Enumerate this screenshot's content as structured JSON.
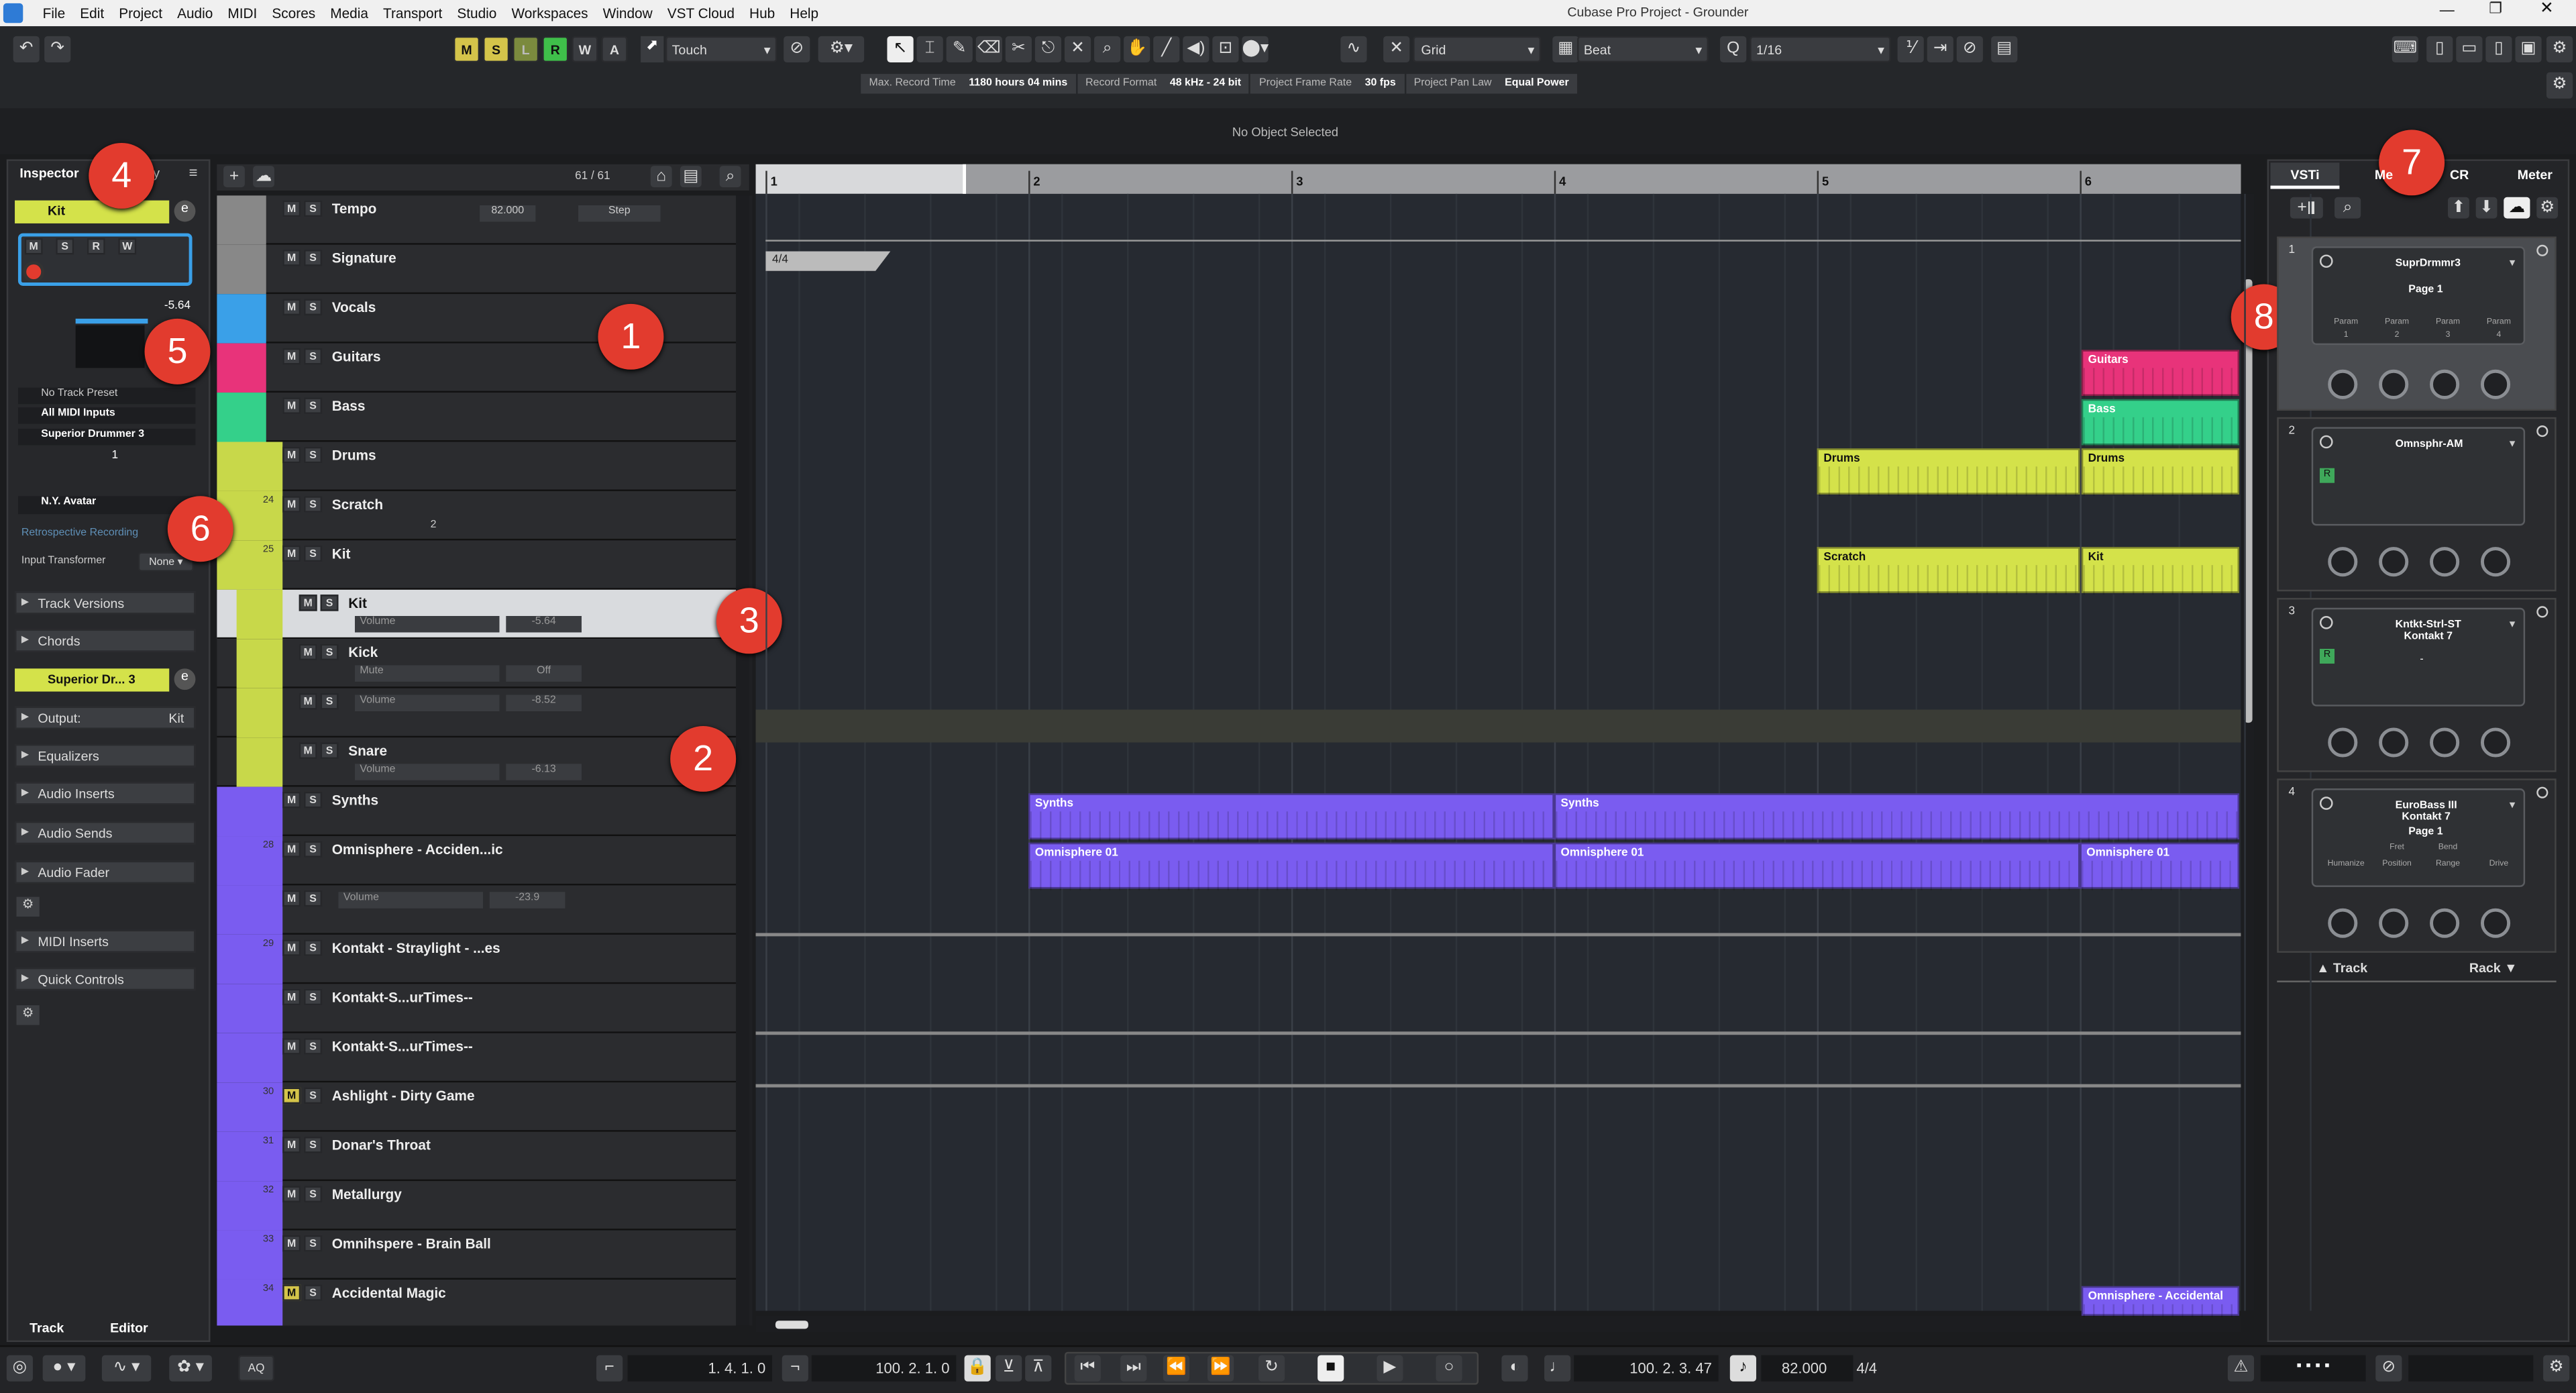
{
  "app": {
    "title": "Cubase Pro Project - Grounder"
  },
  "menu": [
    "File",
    "Edit",
    "Project",
    "Audio",
    "MIDI",
    "Scores",
    "Media",
    "Transport",
    "Studio",
    "Workspaces",
    "Window",
    "VST Cloud",
    "Hub",
    "Help"
  ],
  "toolbar": {
    "mode_buttons": [
      "M",
      "S",
      "L",
      "R",
      "W",
      "A"
    ],
    "automation_mode": "Touch",
    "snap_type": "Grid",
    "grid_type": "Beat",
    "quantize": "1/16"
  },
  "info_bar": {
    "items": [
      {
        "label": "Max. Record Time",
        "value": "1180 hours 04 mins"
      },
      {
        "label": "Record Format",
        "value": "48 kHz - 24 bit"
      },
      {
        "label": "Project Frame Rate",
        "value": "30 fps"
      },
      {
        "label": "Project Pan Law",
        "value": "Equal Power"
      }
    ],
    "status": "No Object Selected"
  },
  "inspector": {
    "tabs": [
      "Inspector",
      "ty"
    ],
    "track_name": "Kit",
    "volume": "-5.64",
    "preset": "No Track Preset",
    "input": "All MIDI Inputs",
    "output_instrument": "Superior Drummer 3",
    "channel": "1",
    "avatar": "N.Y. Avatar",
    "retro": "Retrospective Recording",
    "input_transformer_label": "Input Transformer",
    "input_transformer_value": "None",
    "sections": [
      "Track Versions",
      "Chords"
    ],
    "instrument_header": "Superior Dr... 3",
    "output_label": "Output:",
    "output_value": "Kit",
    "sections2": [
      "Equalizers",
      "Audio Inserts",
      "Audio Sends",
      "Audio Fader"
    ],
    "sections3": [
      "MIDI Inserts",
      "Quick Controls"
    ],
    "bottom_tabs": [
      "Track",
      "Editor"
    ]
  },
  "tracklist": {
    "count": "61 / 61",
    "tracks": [
      {
        "name": "Tempo",
        "extra": "82.000",
        "mode": "Step"
      },
      {
        "name": "Signature"
      },
      {
        "name": "Vocals"
      },
      {
        "name": "Guitars"
      },
      {
        "name": "Bass"
      },
      {
        "name": "Drums"
      },
      {
        "num": "24",
        "name": "Scratch",
        "sub": "2"
      },
      {
        "num": "25",
        "name": "Kit"
      },
      {
        "name": "Kit",
        "param": "Volume",
        "val": "-5.64"
      },
      {
        "name": "Kick",
        "param": "Mute",
        "val": "Off"
      },
      {
        "name": "",
        "param": "Volume",
        "val": "-8.52"
      },
      {
        "name": "Snare",
        "param": "Volume",
        "val": "-6.13"
      },
      {
        "name": "Synths"
      },
      {
        "num": "28",
        "name": "Omnisphere - Acciden...ic"
      },
      {
        "name": "",
        "param": "Volume",
        "val": "-23.9"
      },
      {
        "num": "29",
        "name": "Kontakt - Straylight - ...es"
      },
      {
        "name": "Kontakt-S...urTimes--"
      },
      {
        "name": "Kontakt-S...urTimes--"
      },
      {
        "num": "30",
        "name": "Ashlight - Dirty Game"
      },
      {
        "num": "31",
        "name": "Donar's Throat"
      },
      {
        "num": "32",
        "name": "Metallurgy"
      },
      {
        "num": "33",
        "name": "Omnihspere - Brain Ball"
      },
      {
        "num": "34",
        "name": "Accidental Magic"
      }
    ]
  },
  "ruler": {
    "bars": [
      "1",
      "2",
      "3",
      "4",
      "5",
      "6"
    ],
    "signature": "4/4"
  },
  "clips": {
    "guitars": "Guitars",
    "bass": "Bass",
    "drums1": "Drums",
    "drums2": "Drums",
    "scratch": "Scratch",
    "kit": "Kit",
    "synths1": "Synths",
    "synths2": "Synths",
    "omni1": "Omnisphere 01",
    "omni2": "Omnisphere 01",
    "omni3": "Omnisphere 01",
    "accidental": "Omnisphere - Accidental"
  },
  "rack": {
    "tabs": [
      "VSTi",
      "Me",
      "CR",
      "Meter"
    ],
    "slots": [
      {
        "num": "1",
        "name": "SuprDrmmr3",
        "page": "Page 1",
        "params": [
          "Param",
          "Param",
          "Param",
          "Param"
        ],
        "param_nums": [
          "1",
          "2",
          "3",
          "4"
        ]
      },
      {
        "num": "2",
        "name": "Omnsphr-AM"
      },
      {
        "num": "3",
        "name": "Kntkt-Strl-ST\nKontakt 7",
        "sub": "-"
      },
      {
        "num": "4",
        "name": "EuroBass III\nKontakt 7",
        "page": "Page 1",
        "params": [
          "Humanize",
          "Position",
          "Range",
          "Drive"
        ],
        "params_top": [
          "Fret",
          "Bend"
        ]
      }
    ],
    "bottom": [
      "Track",
      "Rack"
    ]
  },
  "transport": {
    "left_locator": "1. 4. 1. 0",
    "right_locator": "100. 2. 1. 0",
    "position": "100. 2. 3. 47",
    "tempo": "82.000",
    "signature": "4/4",
    "aq": "AQ"
  },
  "markers": [
    "1",
    "2",
    "3",
    "4",
    "5",
    "6",
    "7",
    "8"
  ],
  "colors": {
    "accent_yellow": "#d4e24a",
    "vocals": "#3aa0e8",
    "guitars": "#e8337a",
    "bass": "#34d08a",
    "synths": "#7a5cf0",
    "kit": "#c8d84a"
  }
}
